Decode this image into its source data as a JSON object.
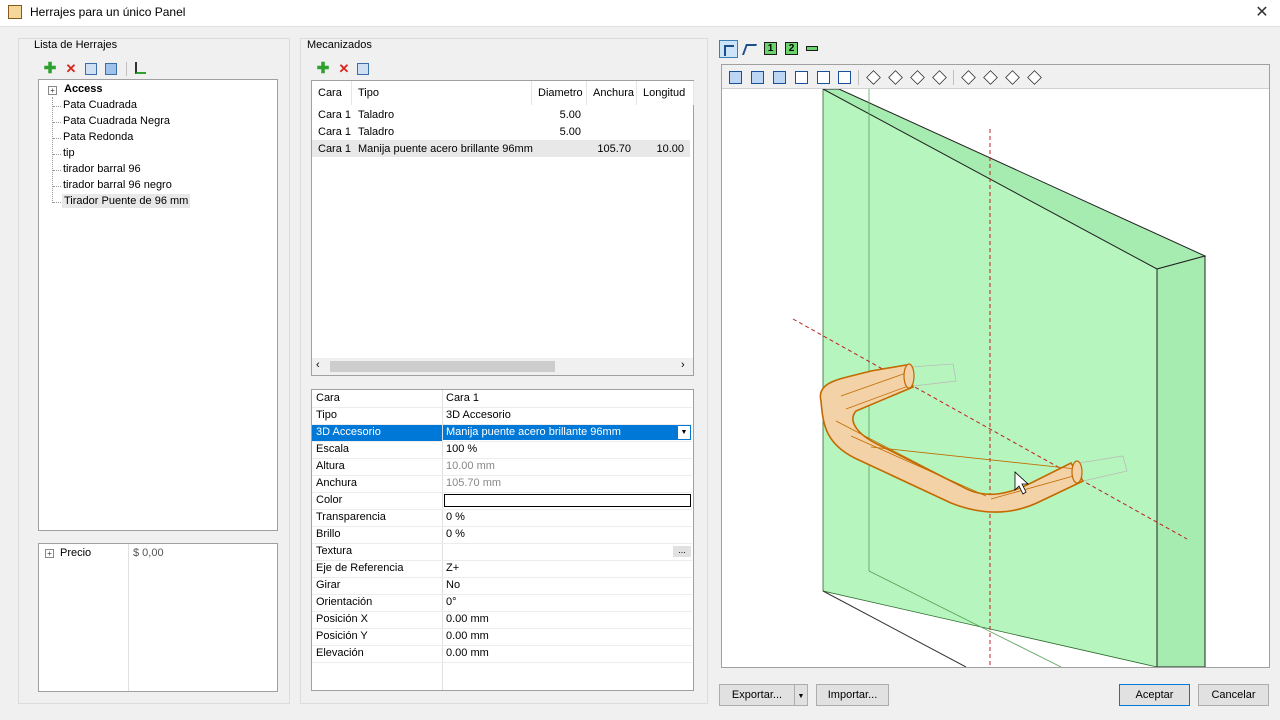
{
  "window": {
    "title": "Herrajes para un único Panel"
  },
  "left": {
    "group_title": "Lista de Herrajes",
    "tree": {
      "root": "Access",
      "items": [
        "Pata Cuadrada",
        "Pata Cuadrada Negra",
        "Pata Redonda",
        "tip",
        "tirador barral 96",
        "tirador barral 96 negro",
        "Tirador Puente de 96 mm"
      ]
    },
    "price": {
      "label": "Precio",
      "value": "$ 0,00"
    }
  },
  "middle": {
    "group_title": "Mecanizados",
    "grid": {
      "headers": [
        "Cara",
        "Tipo",
        "Diametro",
        "Anchura",
        "Longitud"
      ],
      "rows": [
        [
          "Cara 1",
          "Taladro",
          "5.00",
          "",
          ""
        ],
        [
          "Cara 1",
          "Taladro",
          "5.00",
          "",
          ""
        ],
        [
          "Cara 1",
          "Manija puente acero brillante 96mm",
          "",
          "105.70",
          "10.00"
        ]
      ]
    },
    "properties": [
      {
        "name": "Cara",
        "value": "Cara 1"
      },
      {
        "name": "Tipo",
        "value": "3D Accesorio"
      },
      {
        "name": "3D Accesorio",
        "value": "Manija puente acero brillante 96mm"
      },
      {
        "name": "Escala",
        "value": "100 %"
      },
      {
        "name": "Altura",
        "value": "10.00 mm"
      },
      {
        "name": "Anchura",
        "value": "105.70 mm"
      },
      {
        "name": "Color",
        "value": ""
      },
      {
        "name": "Transparencia",
        "value": "0 %"
      },
      {
        "name": "Brillo",
        "value": "0 %"
      },
      {
        "name": "Textura",
        "value": ""
      },
      {
        "name": "Eje de Referencia",
        "value": "Z+"
      },
      {
        "name": "Girar",
        "value": "No"
      },
      {
        "name": "Orientación",
        "value": "0°"
      },
      {
        "name": "Posición X",
        "value": "0.00 mm"
      },
      {
        "name": "Posición Y",
        "value": "0.00 mm"
      },
      {
        "name": "Elevación",
        "value": "0.00 mm"
      }
    ],
    "texture_button": "..."
  },
  "viewer": {
    "mode_icons": [
      "select-tool-icon",
      "angle-tool-icon",
      "view-1-icon",
      "view-2-icon",
      "minus-icon"
    ],
    "mode_labels": [
      "1",
      "2"
    ]
  },
  "footer": {
    "export_label": "Exportar...",
    "import_label": "Importar...",
    "accept_label": "Aceptar",
    "cancel_label": "Cancelar"
  },
  "colors": {
    "selection": "#0078d7",
    "panel_green": "#b6f5bd",
    "handle": "#d98a2a"
  }
}
